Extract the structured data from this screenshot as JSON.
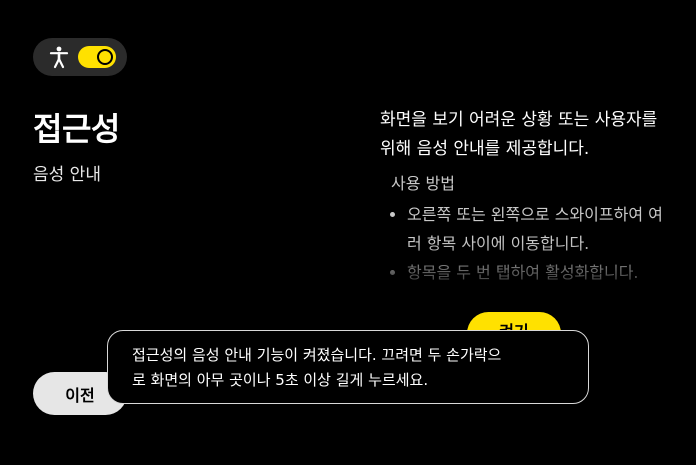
{
  "accessibility_toggle": {
    "icon": "accessibility-person-icon",
    "state": "on",
    "accent_color": "#ffe100"
  },
  "page": {
    "title": "접근성",
    "subtitle": "음성 안내",
    "description_line1": "화면을 보기 어려운 상황 또는 사용자를",
    "description_line2": "위해 음성 안내를 제공합니다."
  },
  "howto": {
    "heading": "사용 방법",
    "items": [
      "오른쪽 또는 왼쪽으로 스와이프하여 여러 항목 사이에 이동합니다.",
      "항목을 두 번 탭하여 활성화합니다."
    ]
  },
  "buttons": {
    "prev_label": "이전",
    "next_label": "켜기"
  },
  "toast": {
    "line1": "접근성의 음성 안내 기능이 켜졌습니다. 끄려면 두 손가락으",
    "line2": "로 화면의 아무 곳이나 5초 이상 길게 누르세요."
  }
}
